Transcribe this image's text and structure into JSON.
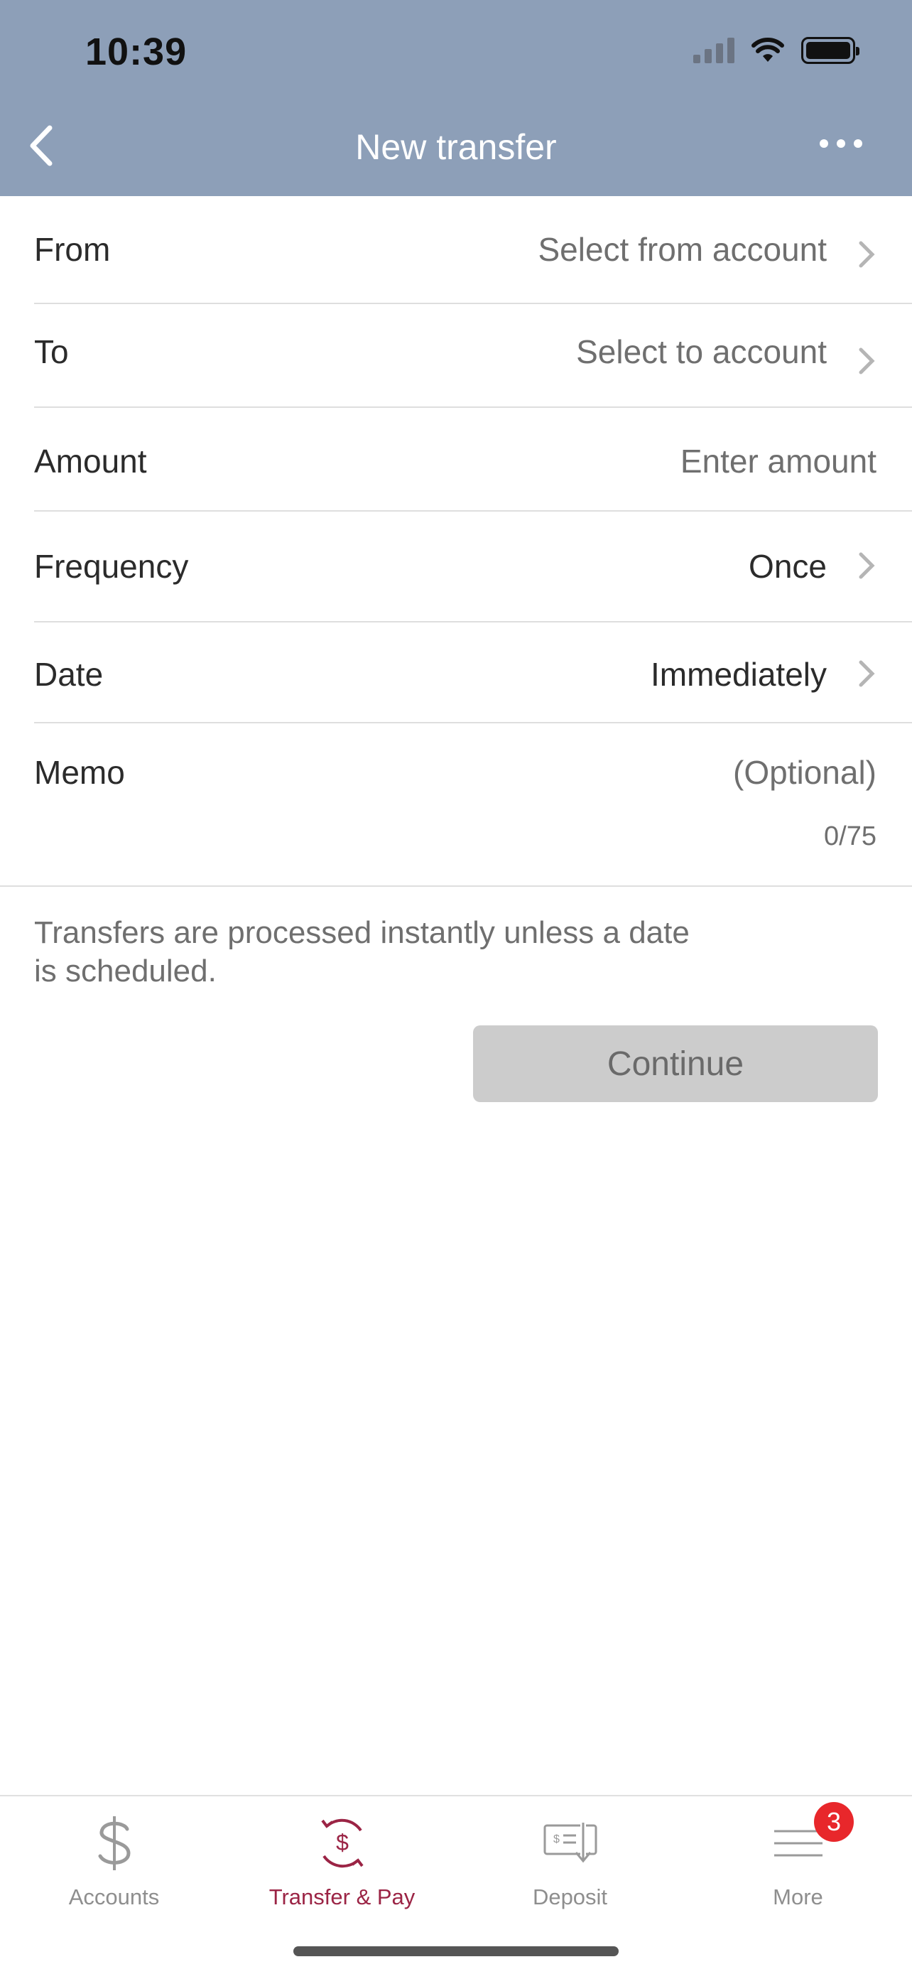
{
  "status": {
    "time": "10:39"
  },
  "nav": {
    "title": "New transfer",
    "back_icon": "chevron-left-icon",
    "more_icon": "ellipsis-icon"
  },
  "form": {
    "from": {
      "label": "From",
      "value": "Select from account"
    },
    "to": {
      "label": "To",
      "value": "Select to account"
    },
    "amount": {
      "label": "Amount",
      "placeholder": "Enter amount"
    },
    "frequency": {
      "label": "Frequency",
      "value": "Once"
    },
    "date": {
      "label": "Date",
      "value": "Immediately"
    },
    "memo": {
      "label": "Memo",
      "placeholder": "(Optional)",
      "counter": "0/75"
    }
  },
  "info": {
    "line1": "Transfers are processed instantly unless a date",
    "line2": "is scheduled."
  },
  "continue_label": "Continue",
  "tabs": [
    {
      "label": "Accounts",
      "icon": "dollar-icon"
    },
    {
      "label": "Transfer & Pay",
      "icon": "transfer-dollar-icon",
      "active": true
    },
    {
      "label": "Deposit",
      "icon": "check-deposit-icon"
    },
    {
      "label": "More",
      "icon": "menu-icon",
      "badge": "3"
    }
  ],
  "colors": {
    "header": "#8d9fb8",
    "accent": "#9b2445",
    "badge": "#e8272b",
    "disabled_button": "#cccccc"
  }
}
